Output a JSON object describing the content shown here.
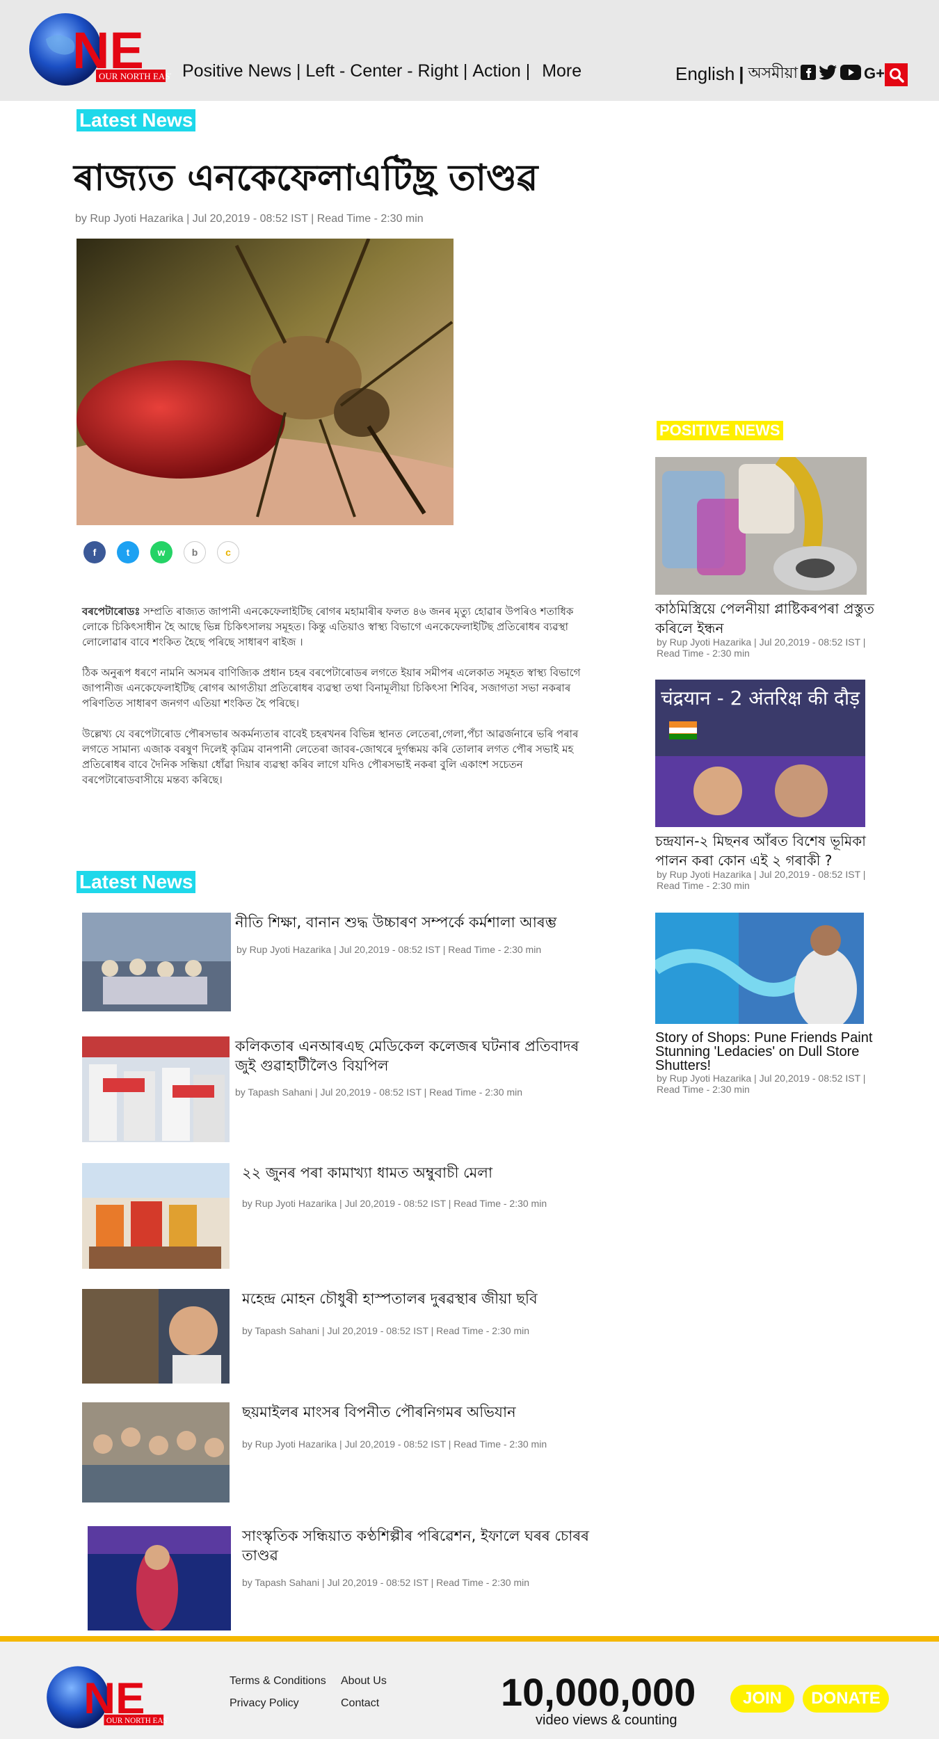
{
  "header": {
    "logo_text": "ONE",
    "logo_sub": "OUR NORTH EAST",
    "nav": [
      "Positive News",
      "Left - Center - Right",
      "Action",
      "More"
    ],
    "nav_sep": " | ",
    "lang_en": "English",
    "lang_as": "অসমীয়া",
    "social": [
      "facebook",
      "twitter",
      "youtube",
      "G+"
    ]
  },
  "main": {
    "section_label": "Latest News",
    "headline": "ৰাজ্যত এনকেফেলাএটিছ্ৰ তাণ্ডৱ",
    "byline": "by Rup Jyoti Hazarika | Jul 20,2019 - 08:52 IST | Read Time - 2:30 min",
    "article": [
      "বৰপেটাৰোডঃ সম্প্ৰতি ৰাজ্যত জাপানী এনকেফেলাইটিছ ৰোগৰ মহামাৰীৰ ফলত ৪৬ জনৰ মৃত্যু হোৱাৰ উপৰিও শতাধিক লোকে চিকিৎসাধীন হৈ আছে ভিন্ন চিকিৎসালয় সমূহত। কিন্তু এতিয়াও স্বাস্থ্য বিভাগে এনকেফেলাইটিছ প্ৰতিৰোধৰ ব্যৱস্থা লোলোৱাৰ বাবে শংকিত হৈছে পৰিছে সাধাৰণ ৰাইজ ।",
      "ঠিক অনুৰূপ ধৰণে নামনি অসমৰ বাণিজ্যিক প্ৰধান চহৰ বৰপেটাৰোডৰ লগতে ইয়াৰ সমীপৰ এলেকাত সমূহত স্বাস্থ্য বিভাগে জাপানীজ এনকেফেলাইটিছ ৰোগৰ আগতীয়া প্ৰতিৰোধৰ ব্যৱস্থা তথা বিনামূলীয়া চিকিৎসা শিবিৰ, সজাগতা সভা নকৰাৰ পৰিণতিত সাধাৰণ জনগণ এতিয়া শংকিত হৈ পৰিছে।",
      "উল্লেখ্য যে বৰপেটাৰোড পৌৰসভাৰ অকৰ্মন্যতাৰ বাবেই চহৰখনৰ বিভিন্ন স্থানত লেতেৰা,গেলা,পঁচা আৱৰ্জনাৰে ভৰি পৰাৰ লগতে সামান্য এজাক বৰষুণ দিলেই কৃত্ৰিম বানপানী লেতেৰা জাবৰ-জোথৰে দুৰ্গন্ধময় কৰি তোলাৰ লগত পৌৰ সভাই মহ প্ৰতিৰোধৰ বাবে দৈনিক সন্ধিয়া ধোঁৱা দিয়াৰ ব্যৱস্থা কৰিব লাগে যদিও পৌৰসভাই নকৰা বুলি একাংশ সচেতন বৰপেটাৰোডবাসীয়ে মন্তব্য কৰিছে।"
    ],
    "article_lead": "বৰপেটাৰোডঃ",
    "share": [
      "f",
      "t",
      "w",
      "b",
      "c"
    ],
    "latest_label": "Latest News",
    "latest": [
      {
        "title": "নীতি শিক্ষা, বানান শুদ্ধ উচ্চাৰণ সম্পৰ্কে কৰ্মশালা আৰম্ভ",
        "byline": "by Rup Jyoti Hazarika | Jul 20,2019 - 08:52 IST | Read Time - 2:30 min"
      },
      {
        "title": "কলিকতাৰ এনআৰএছ মেডিকেল কলেজৰ ঘটনাৰ প্ৰতিবাদৰ জুই গুৱাহাটীলৈও বিয়পিল",
        "byline": "by Tapash Sahani | Jul 20,2019 - 08:52 IST | Read Time - 2:30 min"
      },
      {
        "title": "২২ জুনৰ পৰা কামাখ্যা ধামত অম্বুবাচী মেলা",
        "byline": "by Rup Jyoti Hazarika | Jul 20,2019 - 08:52 IST | Read Time - 2:30 min"
      },
      {
        "title": "মহেন্দ্ৰ মোহন চৌধুৰী হাস্পতালৰ দুৰৱস্থাৰ জীয়া ছবি",
        "byline": "by Tapash Sahani | Jul 20,2019 - 08:52 IST | Read Time - 2:30 min"
      },
      {
        "title": "ছয়মাইলৰ মাংসৰ বিপনীত পৌৰনিগমৰ অভিযান",
        "byline": "by Rup Jyoti Hazarika | Jul 20,2019 - 08:52 IST | Read Time - 2:30 min"
      },
      {
        "title": "সাংস্কৃতিক সন্ধিয়াত কণ্ঠশিল্পীৰ পৰিৱেশন, ইফালে ঘৰৰ চোৰৰ তাণ্ডৱ",
        "byline": "by Tapash Sahani | Jul 20,2019 - 08:52 IST | Read Time - 2:30 min"
      }
    ]
  },
  "sidebar": {
    "label": "POSITIVE NEWS",
    "cards": [
      {
        "title": "কাঠমিস্ত্ৰিয়ে পেলনীয়া প্লাষ্টিকৰপৰা প্ৰস্তুত কৰিলে ইন্ধন",
        "byline": "by Rup Jyoti Hazarika | Jul 20,2019 - 08:52 IST | Read Time - 2:30 min"
      },
      {
        "title": "চন্দ্ৰযান-২ মিছনৰ আঁৰত বিশেষ ভূমিকা পালন কৰা কোন এই ২ গৰাকী ?",
        "byline": "by Rup Jyoti Hazarika | Jul 20,2019 - 08:52 IST | Read Time - 2:30 min",
        "img_text": "चंद्रयान - 2  अंतरिक्ष की दौड़"
      },
      {
        "title": "Story of Shops: Pune Friends Paint Stunning 'Ledacies' on Dull Store Shutters!",
        "byline": "by Rup Jyoti Hazarika | Jul 20,2019 - 08:52 IST | Read Time - 2:30 min"
      }
    ]
  },
  "footer": {
    "links": [
      "Terms & Conditions",
      "About Us",
      "Privacy Policy",
      "Contact"
    ],
    "views": "10,000,000",
    "views_sub": "video views & counting",
    "join": "JOIN",
    "donate": "DONATE"
  },
  "colors": {
    "accent_cyan": "#1ed8ea",
    "accent_yellow": "#ffef00",
    "brand_red": "#e30613",
    "footer_line": "#f5b800"
  }
}
